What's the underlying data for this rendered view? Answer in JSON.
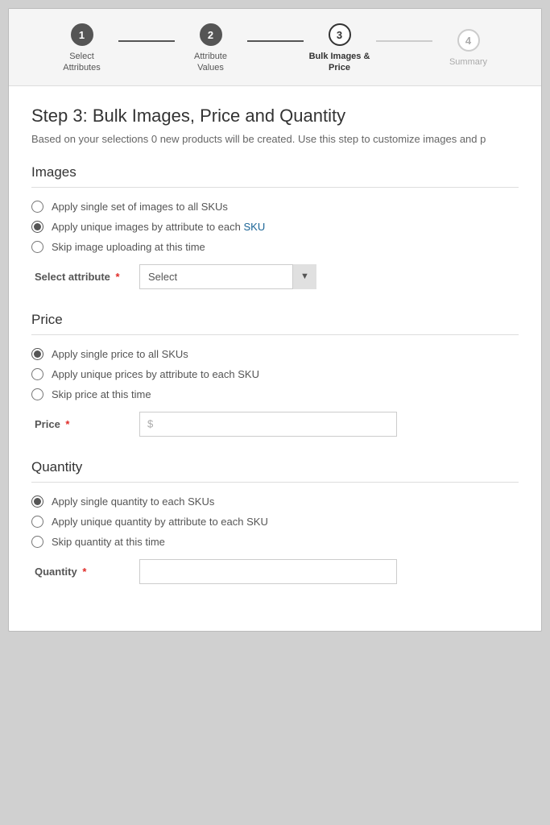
{
  "stepper": {
    "steps": [
      {
        "number": "1",
        "label": "Select\nAttributes",
        "state": "done"
      },
      {
        "number": "2",
        "label": "Attribute\nValues",
        "state": "done"
      },
      {
        "number": "3",
        "label": "Bulk Images &\nPrice",
        "state": "active"
      },
      {
        "number": "4",
        "label": "Summary",
        "state": "inactive"
      }
    ]
  },
  "page": {
    "title": "Step 3: Bulk Images, Price and Quantity",
    "subtitle": "Based on your selections 0 new products will be created. Use this step to customize images and p"
  },
  "images_section": {
    "title": "Images",
    "options": [
      {
        "id": "img1",
        "label": "Apply single set of images to all SKUs",
        "checked": false
      },
      {
        "id": "img2",
        "label": "Apply unique images by attribute to each SKU",
        "checked": true
      },
      {
        "id": "img3",
        "label": "Skip image uploading at this time",
        "checked": false
      }
    ],
    "attribute_label": "Select attribute",
    "required": true,
    "select_placeholder": "Select",
    "select_options": [
      "Select"
    ]
  },
  "price_section": {
    "title": "Price",
    "options": [
      {
        "id": "price1",
        "label": "Apply single price to all SKUs",
        "checked": true
      },
      {
        "id": "price2",
        "label": "Apply unique prices by attribute to each SKU",
        "checked": false
      },
      {
        "id": "price3",
        "label": "Skip price at this time",
        "checked": false
      }
    ],
    "price_label": "Price",
    "required": true,
    "price_prefix": "$",
    "price_placeholder": ""
  },
  "quantity_section": {
    "title": "Quantity",
    "options": [
      {
        "id": "qty1",
        "label": "Apply single quantity to each SKUs",
        "checked": true
      },
      {
        "id": "qty2",
        "label": "Apply unique quantity by attribute to each SKU",
        "checked": false
      },
      {
        "id": "qty3",
        "label": "Skip quantity at this time",
        "checked": false
      }
    ],
    "qty_label": "Quantity",
    "required": true,
    "qty_placeholder": ""
  },
  "icons": {
    "chevron_down": "▼",
    "check": "✓"
  }
}
